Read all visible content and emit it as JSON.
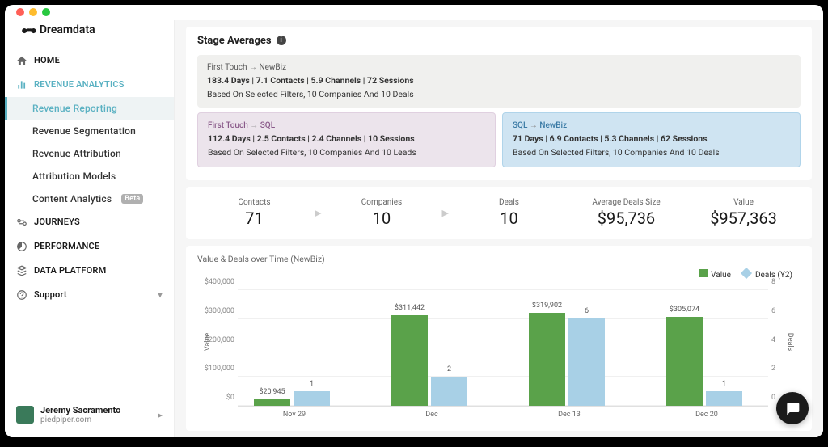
{
  "brand": "Dreamdata",
  "nav": {
    "home": "HOME",
    "rev": "REVENUE ANALYTICS",
    "sub": {
      "reporting": "Revenue Reporting",
      "segmentation": "Revenue Segmentation",
      "attribution": "Revenue Attribution",
      "models": "Attribution Models",
      "content": "Content Analytics",
      "content_badge": "Beta"
    },
    "journeys": "JOURNEYS",
    "perf": "PERFORMANCE",
    "data": "DATA PLATFORM",
    "support": "Support"
  },
  "user": {
    "name": "Jeremy Sacramento",
    "org": "piedpiper.com"
  },
  "stage_title": "Stage Averages",
  "stages": {
    "a": {
      "title_from": "First Touch",
      "title_to": "NewBiz",
      "line1": "183.4 Days | 7.1 Contacts | 5.9 Channels | 72 Sessions",
      "line2": "Based On Selected Filters, 10 Companies And 10 Deals"
    },
    "b": {
      "title_from": "First Touch",
      "title_to": "SQL",
      "line1": "112.4 Days | 2.5 Contacts | 2.4 Channels | 10 Sessions",
      "line2": "Based On Selected Filters, 10 Companies And 10 Leads"
    },
    "c": {
      "title_from": "SQL",
      "title_to": "NewBiz",
      "line1": "71 Days | 6.9 Contacts | 5.3 Channels | 62 Sessions",
      "line2": "Based On Selected Filters, 10 Companies And 10 Deals"
    }
  },
  "kpis": {
    "contacts_label": "Contacts",
    "contacts": "71",
    "companies_label": "Companies",
    "companies": "10",
    "deals_label": "Deals",
    "deals": "10",
    "avg_label": "Average Deals Size",
    "avg": "$95,736",
    "value_label": "Value",
    "value": "$957,363"
  },
  "chart_title": "Value & Deals over Time (NewBiz)",
  "legend": {
    "value": "Value",
    "deals": "Deals (Y2)"
  },
  "chart_data": {
    "type": "bar",
    "categories": [
      "Nov 29",
      "Dec",
      "Dec 13",
      "Dec 20"
    ],
    "xlabel": "",
    "ylabel": "Value",
    "y2label": "Deals",
    "ylim": [
      0,
      400000
    ],
    "y2lim": [
      0,
      8
    ],
    "yticks": [
      "$0",
      "$100,000",
      "$200,000",
      "$300,000",
      "$400,000"
    ],
    "y2ticks": [
      "0",
      "2",
      "4",
      "6",
      "8"
    ],
    "series": [
      {
        "name": "Value",
        "values": [
          20945,
          311442,
          319902,
          305074
        ],
        "labels": [
          "$20,945",
          "$311,442",
          "$319,902",
          "$305,074"
        ]
      },
      {
        "name": "Deals (Y2)",
        "values": [
          1,
          2,
          6,
          1
        ],
        "labels": [
          "1",
          "2",
          "6",
          "1"
        ]
      }
    ]
  }
}
